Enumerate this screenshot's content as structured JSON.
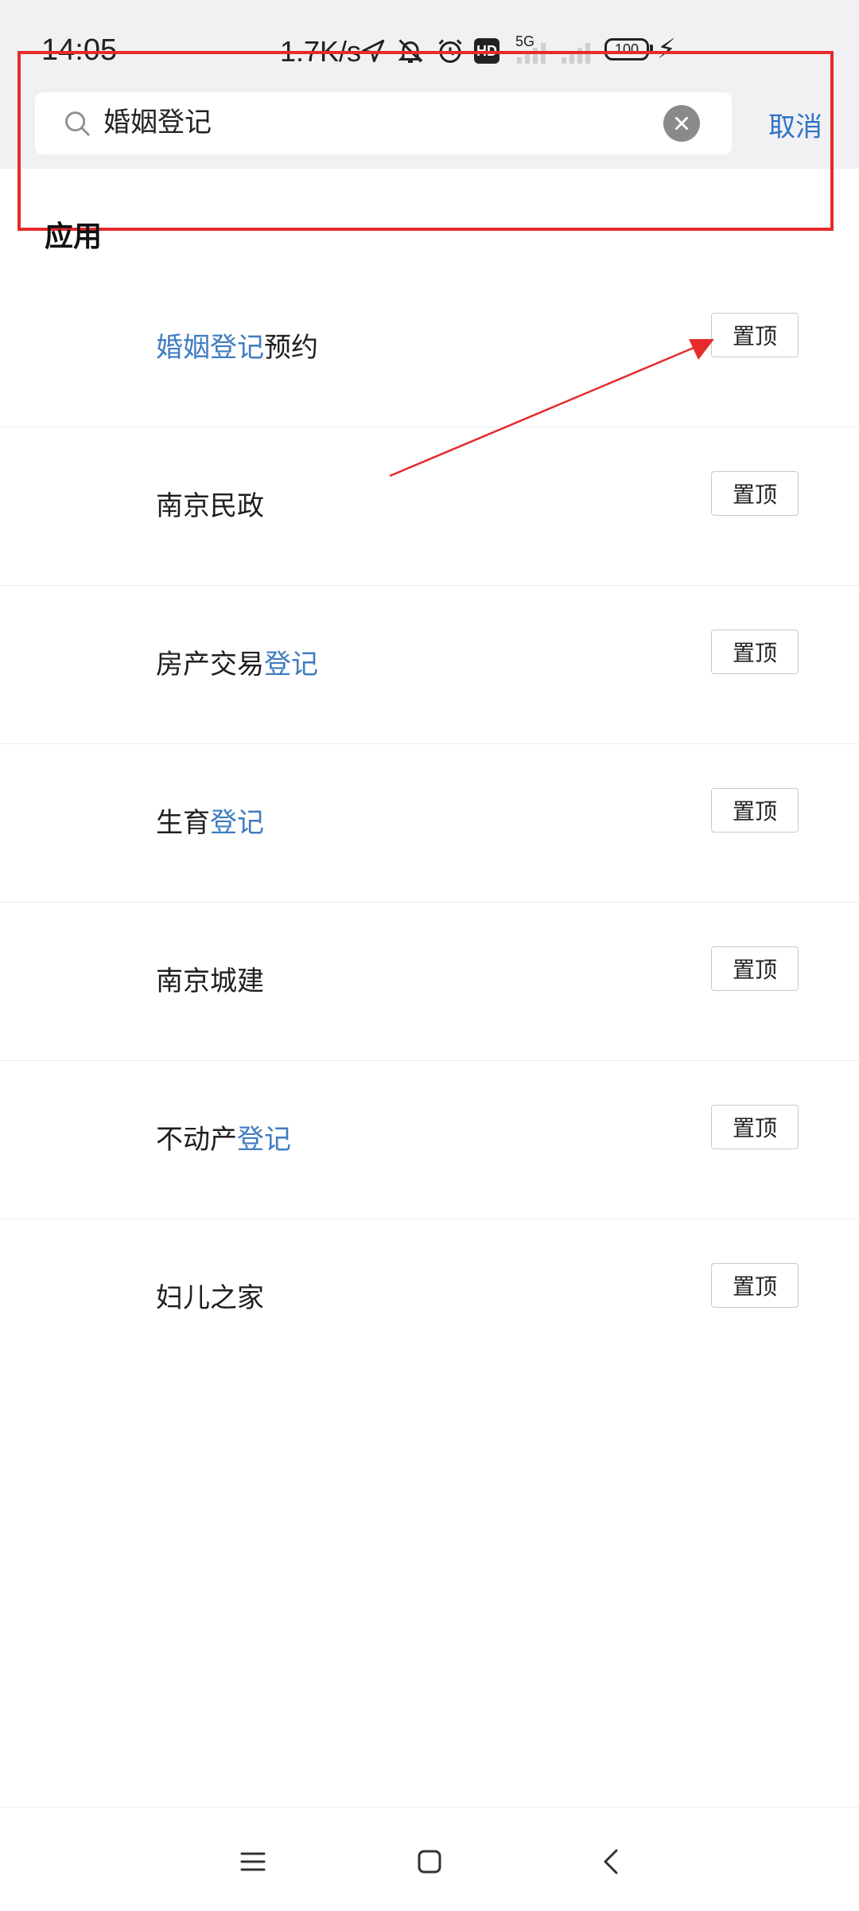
{
  "status_bar": {
    "time": "14:05",
    "net_speed": "1.7K/s",
    "hd_label": "HD",
    "net_type": "5G",
    "battery": "100"
  },
  "search": {
    "query": "婚姻登记",
    "cancel_label": "取消"
  },
  "section_title": "应用",
  "results": [
    {
      "segments": [
        {
          "text": "婚姻登记",
          "hl": true
        },
        {
          "text": "预约",
          "hl": false
        }
      ],
      "pin_label": "置顶"
    },
    {
      "segments": [
        {
          "text": "南京民政",
          "hl": false
        }
      ],
      "pin_label": "置顶"
    },
    {
      "segments": [
        {
          "text": "房产交易",
          "hl": false
        },
        {
          "text": "登记",
          "hl": true
        }
      ],
      "pin_label": "置顶"
    },
    {
      "segments": [
        {
          "text": "生育",
          "hl": false
        },
        {
          "text": "登记",
          "hl": true
        }
      ],
      "pin_label": "置顶"
    },
    {
      "segments": [
        {
          "text": "南京城建",
          "hl": false
        }
      ],
      "pin_label": "置顶"
    },
    {
      "segments": [
        {
          "text": "不动产",
          "hl": false
        },
        {
          "text": "登记",
          "hl": true
        }
      ],
      "pin_label": "置顶"
    },
    {
      "segments": [
        {
          "text": "妇儿之家",
          "hl": false
        }
      ],
      "pin_label": "置顶"
    }
  ],
  "colors": {
    "highlight": "#3f7cc0",
    "cancel": "#2f73c7",
    "annotation": "#e52b2b"
  },
  "icons": [
    "search-icon",
    "clear-icon",
    "menu-icon",
    "home-icon",
    "back-icon",
    "send-icon",
    "alarm-icon",
    "bell-off-icon",
    "bolt-icon"
  ]
}
